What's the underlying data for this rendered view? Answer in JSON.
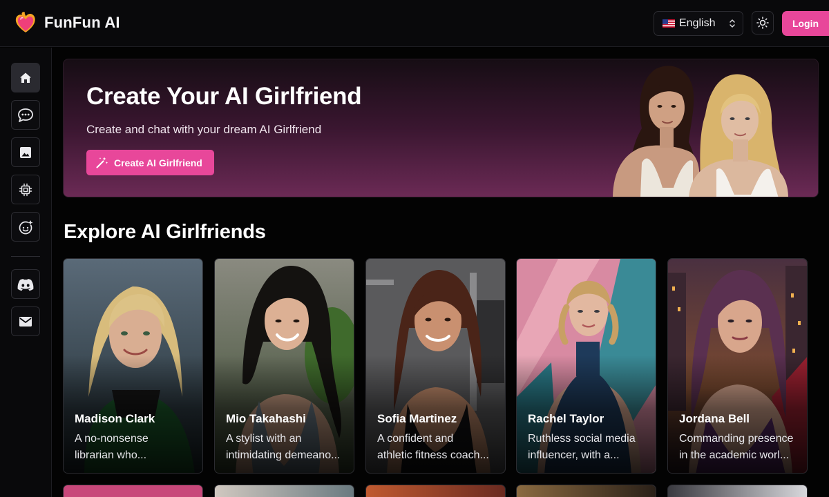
{
  "header": {
    "brand": "FunFun AI",
    "language": "English",
    "login_label": "Login"
  },
  "sidebar": {
    "items": [
      {
        "name": "home",
        "icon": "home-icon",
        "active": true
      },
      {
        "name": "chat",
        "icon": "chat-icon"
      },
      {
        "name": "gallery",
        "icon": "image-icon"
      },
      {
        "name": "generate",
        "icon": "chip-icon"
      },
      {
        "name": "create-character",
        "icon": "face-plus-icon"
      },
      {
        "name": "discord",
        "icon": "discord-icon"
      },
      {
        "name": "mail",
        "icon": "mail-icon"
      }
    ]
  },
  "hero": {
    "title": "Create Your AI Girlfriend",
    "subtitle": "Create and chat with your dream AI Girlfriend",
    "cta_label": "Create AI Girlfriend"
  },
  "explore": {
    "title": "Explore AI Girlfriends",
    "cards": [
      {
        "name": "Madison Clark",
        "desc_line1": "A no-nonsense",
        "desc_line2": "librarian who..."
      },
      {
        "name": "Mio Takahashi",
        "desc_line1": "A stylist with an",
        "desc_line2": "intimidating demeano..."
      },
      {
        "name": "Sofia Martinez",
        "desc_line1": "A confident and",
        "desc_line2": "athletic fitness coach..."
      },
      {
        "name": "Rachel Taylor",
        "desc_line1": "Ruthless social media",
        "desc_line2": "influencer, with a..."
      },
      {
        "name": "Jordana Bell",
        "desc_line1": "Commanding presence",
        "desc_line2": "in the academic worl..."
      }
    ]
  },
  "colors": {
    "accent": "#e8479a",
    "background": "#030303",
    "panel": "#09090b"
  }
}
